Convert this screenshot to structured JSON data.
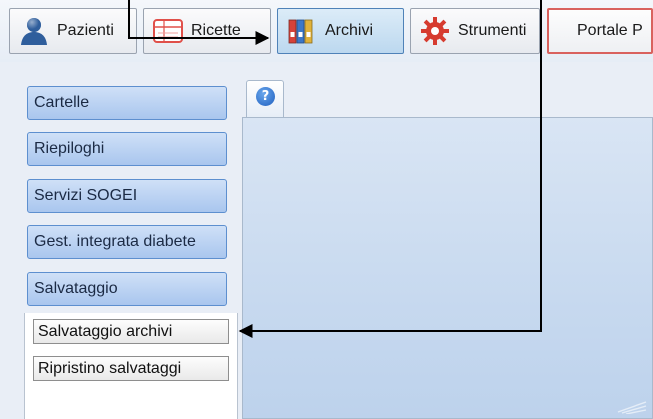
{
  "toolbar": {
    "buttons": [
      {
        "label": "Pazienti",
        "icon": "user-icon"
      },
      {
        "label": "Ricette",
        "icon": "prescription-icon"
      },
      {
        "label": "Archivi",
        "icon": "archive-binders-icon"
      },
      {
        "label": "Strumenti",
        "icon": "gear-icon"
      },
      {
        "label": "Portale P"
      }
    ]
  },
  "sidebar": {
    "items": [
      {
        "label": "Cartelle"
      },
      {
        "label": "Riepiloghi"
      },
      {
        "label": "Servizi SOGEI"
      },
      {
        "label": "Gest. integrata diabete"
      },
      {
        "label": "Salvataggio"
      }
    ],
    "submenu": [
      {
        "label": "Salvataggio archivi"
      },
      {
        "label": "Ripristino salvataggi"
      }
    ]
  },
  "main": {
    "tab_icon": "help-icon",
    "tab_glyph": "?"
  },
  "colors": {
    "nav_button": "#a9c6ee",
    "active_toolbar": "#bcd8ef",
    "portale_border": "#d9625e"
  }
}
